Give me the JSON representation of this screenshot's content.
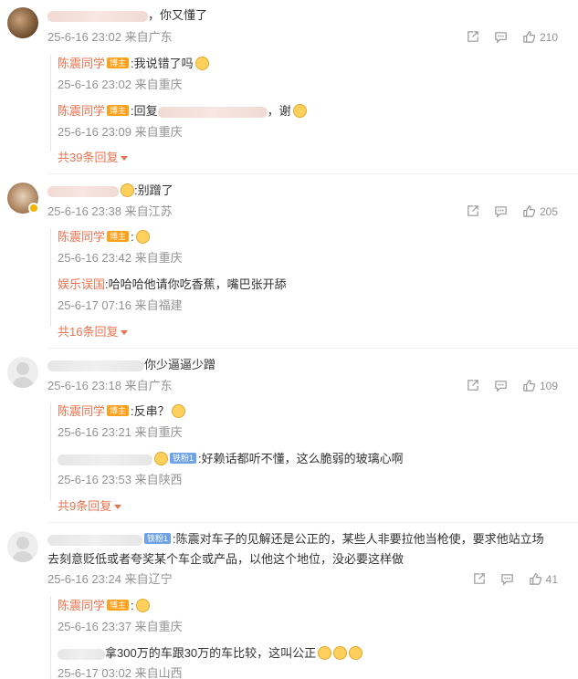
{
  "comments": [
    {
      "text": "，你又懂了",
      "meta": "25-6-16 23:02 来自广东",
      "likes": "210",
      "replies": [
        {
          "user": "陈震同学",
          "badge": "博主",
          "text": ":我说错了吗",
          "meta": "25-6-16 23:02 来自重庆"
        },
        {
          "user": "陈震同学",
          "badge": "博主",
          "text_prefix": ":回复",
          "text_suffix": "，谢",
          "meta": "25-6-16 23:09 来自重庆"
        }
      ],
      "more": "共39条回复"
    },
    {
      "text": ":别蹭了",
      "meta": "25-6-16 23:38 来自江苏",
      "likes": "205",
      "replies": [
        {
          "user": "陈震同学",
          "badge": "博主",
          "text": ":",
          "meta": "25-6-16 23:42 来自重庆"
        },
        {
          "user": "娱乐误国",
          "text": ":哈哈哈他请你吃香蕉，嘴巴张开舔",
          "meta": "25-6-17 07:16 来自福建"
        }
      ],
      "more": "共16条回复"
    },
    {
      "text": "你少逼逼少蹭",
      "meta": "25-6-16 23:18 来自广东",
      "likes": "109",
      "replies": [
        {
          "user": "陈震同学",
          "badge": "博主",
          "text": ":反串？",
          "meta": "25-6-16 23:21 来自重庆"
        },
        {
          "badge": "铁粉1",
          "text": ":好赖话都听不懂，这么脆弱的玻璃心啊",
          "meta": "25-6-16 23:53 来自陕西"
        }
      ],
      "more": "共9条回复"
    },
    {
      "badge": "铁粉1",
      "text": ":陈震对车子的见解还是公正的，某些人非要拉他当枪使，要求他站立场",
      "text2": "去刻意贬低或者夸奖某个车企或产品，以他这个地位，没必要这样做",
      "meta": "25-6-16 23:24 来自辽宁",
      "likes": "41",
      "replies": [
        {
          "user": "陈震同学",
          "badge": "博主",
          "text": ":",
          "meta": "25-6-16 23:37 来自重庆"
        },
        {
          "text": "拿300万的车跟30万的车比较，这叫公正",
          "meta": "25-6-17 03:02 来自山西"
        }
      ]
    }
  ],
  "icons": [
    "share-icon",
    "comment-icon",
    "like-icon"
  ],
  "colors": {
    "username": "#eb7350",
    "meta": "#939393",
    "blogger_badge": "#ffa11a",
    "fan_badge": "#6fa3e6"
  }
}
